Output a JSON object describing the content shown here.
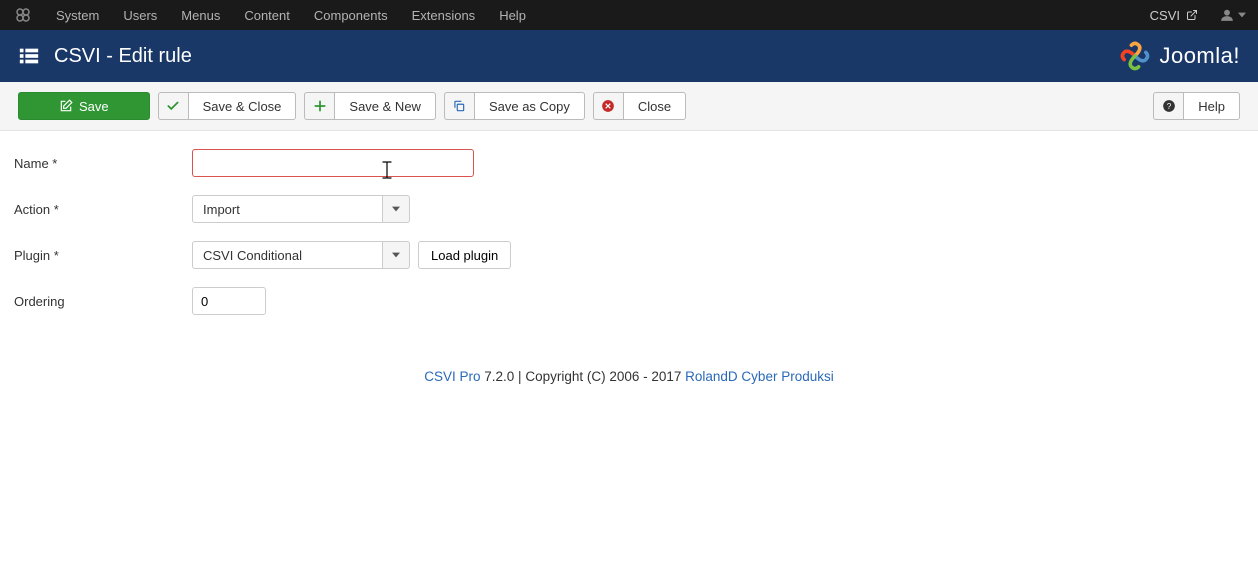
{
  "adminbar": {
    "items": [
      "System",
      "Users",
      "Menus",
      "Content",
      "Components",
      "Extensions",
      "Help"
    ],
    "right_link": "CSVI"
  },
  "titlebar": {
    "title": "CSVI - Edit rule",
    "brand": "Joomla!"
  },
  "toolbar": {
    "save": "Save",
    "save_close": "Save & Close",
    "save_new": "Save & New",
    "save_copy": "Save as Copy",
    "close": "Close",
    "help": "Help"
  },
  "form": {
    "name_label": "Name *",
    "name_value": "",
    "action_label": "Action *",
    "action_value": "Import",
    "plugin_label": "Plugin *",
    "plugin_value": "CSVI Conditional",
    "load_plugin": "Load plugin",
    "ordering_label": "Ordering",
    "ordering_value": "0"
  },
  "footer": {
    "product": "CSVI Pro",
    "version_text": " 7.2.0 | Copyright (C) 2006 - 2017 ",
    "vendor": "RolandD Cyber Produksi"
  }
}
